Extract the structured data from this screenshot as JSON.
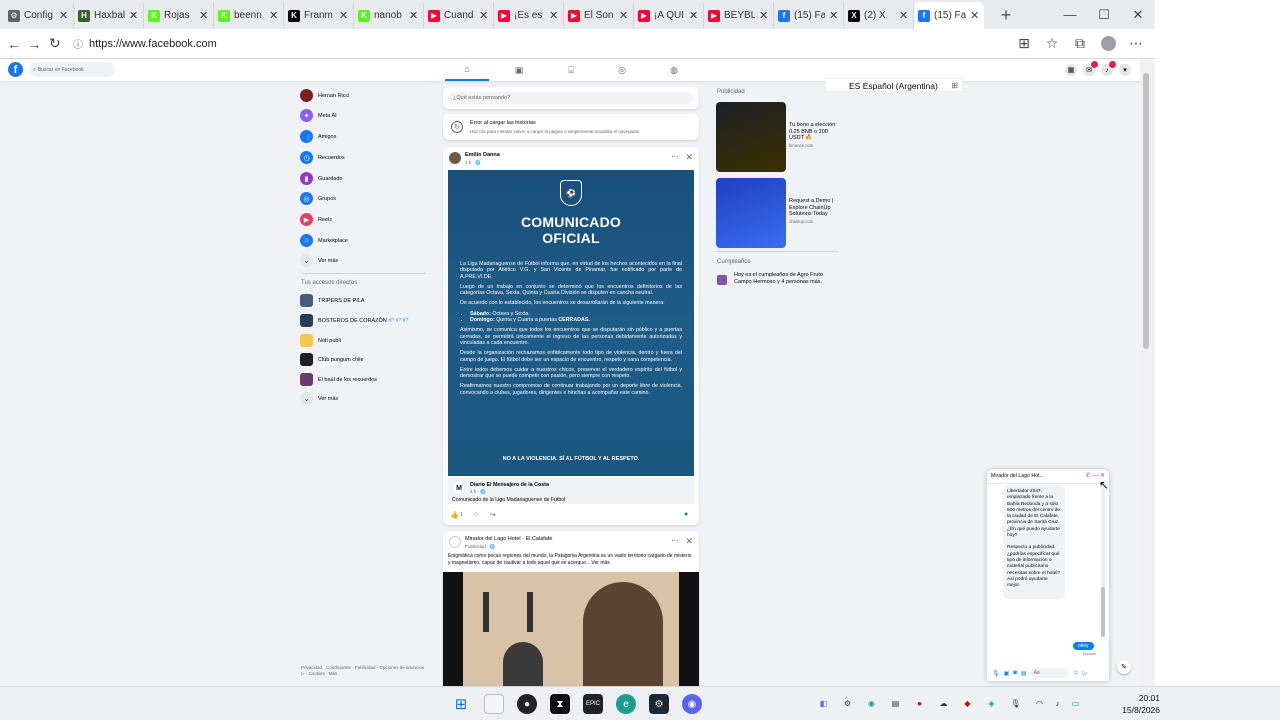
{
  "browser": {
    "tabs": [
      {
        "label": "Config",
        "icon": "gear-icon",
        "color": "#5f6368"
      },
      {
        "label": "Haxbal",
        "icon": "haxball-icon",
        "color": "#3b5f2a"
      },
      {
        "label": "Rojas",
        "icon": "kick-icon",
        "color": "#53fc18"
      },
      {
        "label": "beenn",
        "icon": "kick-icon",
        "color": "#53fc18"
      },
      {
        "label": "Franm",
        "icon": "kick-icon",
        "color": "#000000"
      },
      {
        "label": "nanob",
        "icon": "kick-icon",
        "color": "#53fc18"
      },
      {
        "label": "Cuand",
        "icon": "youtube-icon",
        "color": "#ff0033"
      },
      {
        "label": "¡Es es",
        "icon": "youtube-icon",
        "color": "#ff0033"
      },
      {
        "label": "El Son",
        "icon": "youtube-icon",
        "color": "#ff0033"
      },
      {
        "label": "¡A QUI",
        "icon": "youtube-icon",
        "color": "#ff0033"
      },
      {
        "label": "BEYBL",
        "icon": "youtube-icon",
        "color": "#ff0033"
      },
      {
        "label": "(15) Fa",
        "icon": "facebook-icon",
        "color": "#1877f2"
      },
      {
        "label": "(2) X",
        "icon": "x-icon",
        "color": "#000000"
      },
      {
        "label": "(15) Fa",
        "icon": "facebook-icon",
        "color": "#1877f2",
        "active": true
      }
    ],
    "url": "https://www.facebook.com"
  },
  "fb": {
    "search_placeholder": "Buscar en Facebook",
    "left_nav": [
      {
        "label": "Hernan Ricci",
        "icon": "avatar",
        "color": "#7a1f1f"
      },
      {
        "label": "Meta AI",
        "icon": "meta-ai-icon",
        "color": "#8a5cf6"
      },
      {
        "label": "Amigos",
        "icon": "friends-icon",
        "color": "#1877f2"
      },
      {
        "label": "Recuerdos",
        "icon": "memories-icon",
        "color": "#1877f2"
      },
      {
        "label": "Guardado",
        "icon": "saved-icon",
        "color": "#8e3cc8"
      },
      {
        "label": "Grupos",
        "icon": "groups-icon",
        "color": "#1877f2"
      },
      {
        "label": "Reels",
        "icon": "reels-icon",
        "color": "#e4405f"
      },
      {
        "label": "Marketplace",
        "icon": "marketplace-icon",
        "color": "#1877f2"
      },
      {
        "label": "Ver más",
        "icon": "chevron-down-icon",
        "color": "#e4e6eb"
      }
    ],
    "shortcuts_title": "Tus accesos directos",
    "shortcuts": [
      {
        "label": "TRIPERS DE PILA",
        "color": "#4a5a78"
      },
      {
        "label": "BOSTEROS DE CORAZÓN 💎💎💎",
        "color": "#2b3a55"
      },
      {
        "label": "Noti publi",
        "color": "#f2c94c"
      },
      {
        "label": "Club pungum chile",
        "color": "#222222"
      },
      {
        "label": "El baúl de los recuerdos",
        "color": "#6b3b6b"
      },
      {
        "label": "Ver más",
        "color": "#e4e6eb"
      }
    ],
    "footer": "Privacidad · Condiciones · Publicidad · Opciones de anuncios ▷ · Cookies · Más",
    "composer_placeholder": "¿Qué estás pensando?",
    "story_error": {
      "title": "Error al cargar las historias",
      "subtitle": "Haz clic para intentar volver a cargar la página o simplemente actualiza el navegador"
    },
    "post1": {
      "author": "Emilio Danna",
      "meta": "1 h · 🌐",
      "image_title_1": "COMUNICADO",
      "image_title_2": "OFICIAL",
      "p1": "La Liga Madariaguense de Fútbol informa que, en virtud de los hechos acontecidos en la final disputada por Atlético V.G. y San Vicente de Pinamar, fue notificado por parte de A.PRE.VI.DE.",
      "p2": "Luego de un trabajo en conjunto se determinó que los encuentros definitorios de las categorías Octava, Sexta, Quinta y Cuarta División se disputen en cancha neutral.",
      "p3": "De acuerdo con lo establecido, los encuentros se desarrollarán de la siguiente manera:",
      "li1_b": "Sábado:",
      "li1": " Octava y Sexta.",
      "li2_b": "Domingo:",
      "li2": " Quinta y Cuarta a puertas ",
      "li2_end": "CERRADAS.",
      "p4": "Asimismo, se comunica que todos los encuentros que se disputarán sin público y a puertas cerradas, se permitirá únicamente el ingreso de las personas debidamente autorizadas y vinculadas a cada encuentro.",
      "p5": "Desde la organización rechazamos enfáticamente todo tipo de violencia, dentro y fuera del campo de juego. El fútbol debe ser un espacio de encuentro, respeto y sana competencia.",
      "p6": "Entre todos debemos cuidar a nuestros chicos, preservar el verdadero espíritu del fútbol y demostrar que se puede competir con pasión, pero siempre con respeto.",
      "p7": "Reafirmamos nuestro compromiso de continuar trabajando por un deporte libre de violencia, convocando a clubes, jugadores, dirigentes e hinchas a acompañar este camino.",
      "footer": "NO A LA VIOLENCIA. SÍ AL FÚTBOL Y AL RESPETO.",
      "shared_name": "Diario El Mensajero de la Costa",
      "shared_meta": "4 h · 🌐",
      "caption": "Comunicado de la Liga Madariaguense de Fútbol",
      "reactions": "1"
    },
    "post2": {
      "author": "Mirador del Lago Hotel - El Calafate",
      "meta": "Publicidad · 🌐",
      "text": "Enigmática como pocas regiones del mundo, la Patagonia Argentina es un vasto territorio cargado de misterio y magnetismo, capaz de cautivar a todo aquel que se acerque... Ver más"
    },
    "right": {
      "ads_title": "Publicidad",
      "ads": [
        {
          "text": "Tu bono a elección: 0.25 BNB o 200 USDT 🔥",
          "domain": "binance.com",
          "color": "#1e2026"
        },
        {
          "text": "Request a Demo | Explore ChainUp Solutions Today",
          "domain": "chainup.com",
          "color": "#1f3fc2"
        }
      ],
      "birthdays_title": "Cumpleaños",
      "birthdays": "Hoy es el cumpleaños de Agro Fruto Campo Hermoso y 4 personas más."
    },
    "lang_box": "ES Español (Argentina)",
    "chat": {
      "title": "Mirador del Lago Hot...",
      "msg1": "Libertador 2047, emplazado frente a la Bahía Redonda y a sólo 500 metros del centro de la ciudad de El Calafate, provincia de Santa Cruz. ¿En qué puedo ayudarte hoy?",
      "msg2": "Respecto a publicidad, ¿podrías especificar qué tipo de información o material publicitario necesitas sobre el hotel? Así podré ayudarte mejor.",
      "reply": "okey",
      "sent": "Enviado",
      "input_placeholder": "Aa"
    }
  },
  "taskbar": {
    "time": "20:01",
    "date": "15/8/2026"
  }
}
